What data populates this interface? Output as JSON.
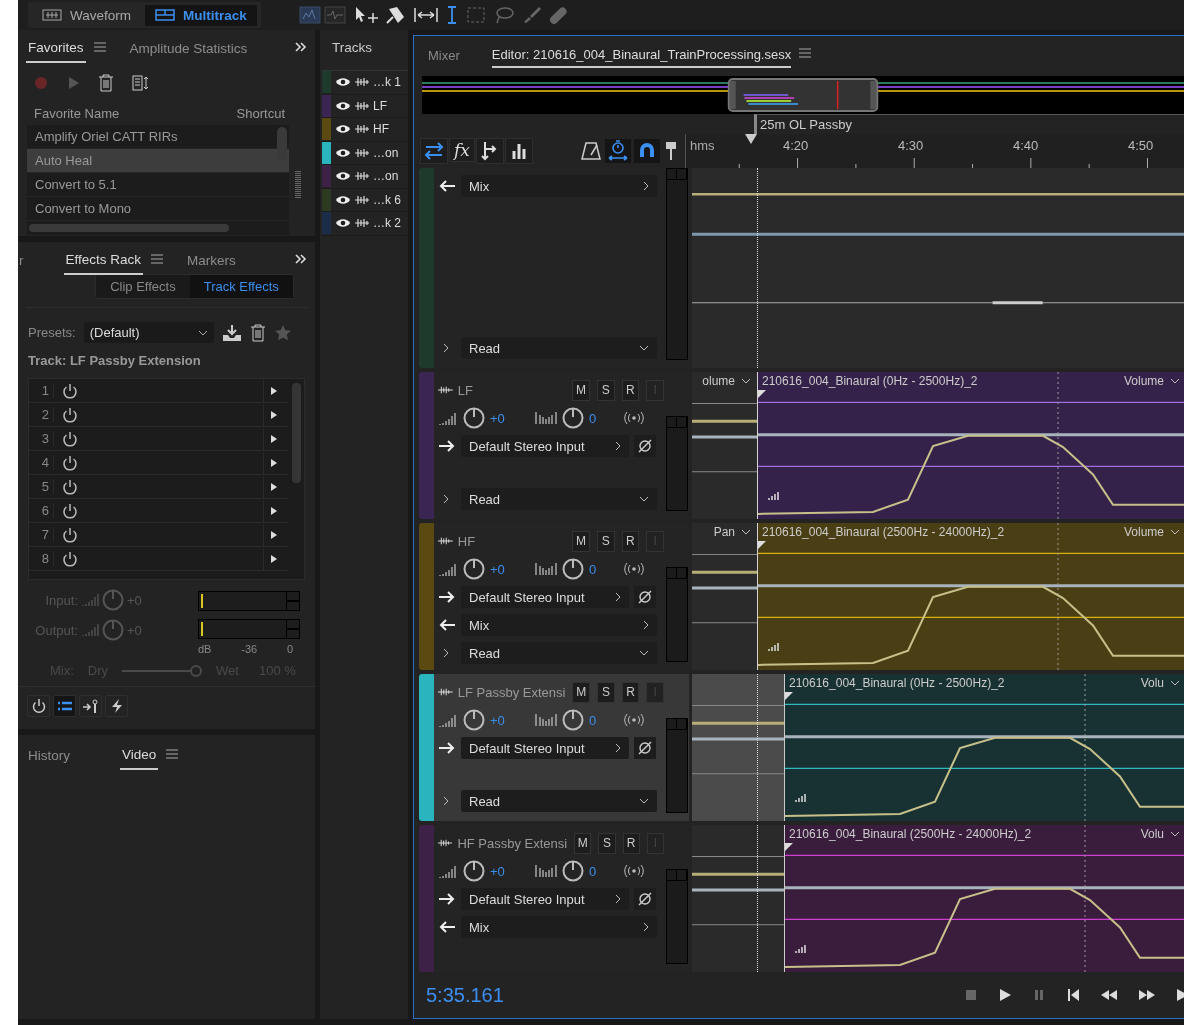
{
  "workspace": {
    "tabs": [
      {
        "label": "Waveform",
        "kind": "waveform",
        "selected": false
      },
      {
        "label": "Multitrack",
        "kind": "multitrack",
        "selected": true
      }
    ]
  },
  "favorites": {
    "tabs": [
      {
        "label": "Favorites",
        "selected": true
      },
      {
        "label": "Amplitude Statistics",
        "selected": false
      }
    ],
    "columns": [
      "Favorite Name",
      "Shortcut"
    ],
    "items": [
      {
        "name": "Amplify Oriel CATT RIRs",
        "selected": false
      },
      {
        "name": "Auto Heal",
        "selected": true
      },
      {
        "name": "Convert to 5.1",
        "selected": false
      },
      {
        "name": "Convert to Mono",
        "selected": false
      }
    ]
  },
  "effects": {
    "tabs": [
      {
        "label": "r",
        "selected": false
      },
      {
        "label": "Effects Rack",
        "selected": true
      },
      {
        "label": "Markers",
        "selected": false
      }
    ],
    "modes": [
      {
        "label": "Clip Effects",
        "selected": false
      },
      {
        "label": "Track Effects",
        "selected": true
      }
    ],
    "presets_label": "Presets:",
    "preset": "(Default)",
    "track": "Track: LF Passby Extension",
    "slots": [
      "1",
      "2",
      "3",
      "4",
      "5",
      "6",
      "7",
      "8"
    ],
    "gains": [
      {
        "label": "Input:",
        "value": "+0"
      },
      {
        "label": "Output:",
        "value": "+0"
      }
    ],
    "scale": [
      "dB",
      "-36",
      "0"
    ],
    "mix": {
      "label": "Mix:",
      "dry": "Dry",
      "wet": "Wet",
      "reading": "100 %",
      "level": 1
    },
    "footer": [
      {
        "kind": "power",
        "selected": false
      },
      {
        "kind": "list",
        "selected": true
      },
      {
        "kind": "routing",
        "selected": false
      },
      {
        "kind": "bolt",
        "selected": false
      }
    ]
  },
  "bottom_panel": {
    "tabs": [
      {
        "label": "History",
        "selected": false
      },
      {
        "label": "Video",
        "selected": true
      }
    ]
  },
  "tracks_panel": {
    "title": "Tracks",
    "items": [
      {
        "label": "…k 1",
        "color": "#1e3a2c"
      },
      {
        "label": "LF",
        "color": "#3b2553"
      },
      {
        "label": "HF",
        "color": "#5a4a12"
      },
      {
        "label": "…on",
        "color": "#2ab5be"
      },
      {
        "label": "…on",
        "color": "#3e2146"
      },
      {
        "label": "…k 6",
        "color": "#2b3a20"
      },
      {
        "label": "…k 2",
        "color": "#1b2d48"
      }
    ]
  },
  "editor": {
    "tabs": [
      {
        "label": "Mixer",
        "selected": false
      },
      {
        "label": "Editor: 210616_004_Binaural_TrainProcessing.sesx",
        "selected": true
      }
    ],
    "marker": "25m OL Passby",
    "fx": "fx",
    "ruler": {
      "unit": "hms",
      "ticks": [
        "4:20",
        "4:30",
        "4:40",
        "4:50"
      ]
    },
    "tracks": [
      {
        "kind": "partial",
        "color": "#1e3a2c",
        "selected": false,
        "output": "Mix",
        "automation": "Read"
      },
      {
        "kind": "full",
        "name": "LF",
        "color": "#3b2553",
        "selected": false,
        "buttons": [
          {
            "label": "M",
            "disabled": false
          },
          {
            "label": "S",
            "disabled": false
          },
          {
            "label": "R",
            "disabled": false
          },
          {
            "label": "I",
            "disabled": true
          }
        ],
        "volume": "+0",
        "pan": "0",
        "input": "Default Stereo Input",
        "automation": "Read",
        "lane": "olume",
        "clip": {
          "kind": "main",
          "name": "210616_004_Binaural (0Hz - 2500Hz)_2",
          "param": "Volume",
          "color": "#35224a",
          "guide": {
            "color": "#a070e0"
          }
        }
      },
      {
        "kind": "full",
        "name": "HF",
        "color": "#5a4a12",
        "selected": false,
        "buttons": [
          {
            "label": "M",
            "disabled": false
          },
          {
            "label": "S",
            "disabled": false
          },
          {
            "label": "R",
            "disabled": false
          },
          {
            "label": "I",
            "disabled": true
          }
        ],
        "volume": "+0",
        "pan": "0",
        "input": "Default Stereo Input",
        "output": "Mix",
        "automation": "Read",
        "lane": "Pan",
        "clip": {
          "kind": "main",
          "name": "210616_004_Binaural (2500Hz - 24000Hz)_2",
          "param": "Volume",
          "color": "#4a3f14",
          "guide": {
            "color": "#d8b010"
          }
        }
      },
      {
        "kind": "full",
        "name": "LF Passby Extensi",
        "color": "#2ab5be",
        "selected": true,
        "buttons": [
          {
            "label": "M",
            "disabled": false
          },
          {
            "label": "S",
            "disabled": false
          },
          {
            "label": "R",
            "disabled": false
          },
          {
            "label": "I",
            "disabled": true
          }
        ],
        "volume": "+0",
        "pan": "0",
        "input": "Default Stereo Input",
        "automation": "Read",
        "clip": {
          "kind": "extension",
          "name": "210616_004_Binaural (0Hz - 2500Hz)_2",
          "param": "Volu",
          "color": "#183233",
          "guide": {
            "color": "#30b8c0"
          }
        }
      },
      {
        "kind": "full",
        "name": "HF Passby Extensi",
        "color": "#3e2146",
        "selected": false,
        "buttons": [
          {
            "label": "M",
            "disabled": false
          },
          {
            "label": "S",
            "disabled": false
          },
          {
            "label": "R",
            "disabled": false
          },
          {
            "label": "I",
            "disabled": true
          }
        ],
        "volume": "+0",
        "pan": "0",
        "input": "Default Stereo Input",
        "output": "Mix",
        "clip": {
          "kind": "extension",
          "name": "210616_004_Binaural (2500Hz - 24000Hz)_2",
          "param": "Volu",
          "color": "#3a1c3c",
          "guide": {
            "color": "#d040d0"
          }
        }
      }
    ],
    "time": "5:35.161"
  }
}
